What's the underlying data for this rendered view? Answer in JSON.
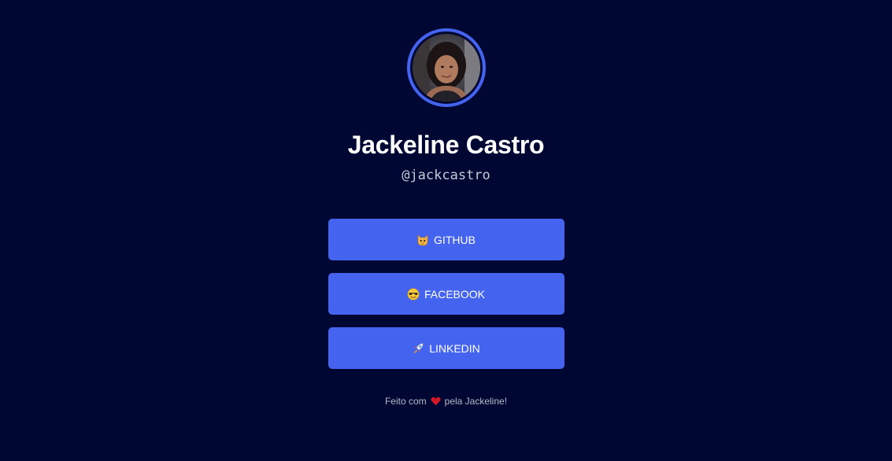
{
  "profile": {
    "name": "Jackeline Castro",
    "handle": "@jackcastro"
  },
  "links": [
    {
      "label": "GITHUB",
      "icon": "cat-emoji-icon"
    },
    {
      "label": "FACEBOOK",
      "icon": "sunglasses-emoji-icon"
    },
    {
      "label": "LINKEDIN",
      "icon": "rocket-emoji-icon"
    }
  ],
  "footer": {
    "prefix": "Feito com",
    "icon": "heart-icon",
    "suffix": "pela Jackeline!"
  },
  "colors": {
    "background": "#000732",
    "accent": "#4464ef",
    "heart": "#d1192a"
  }
}
